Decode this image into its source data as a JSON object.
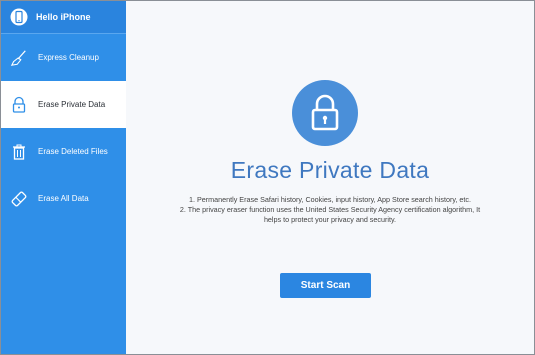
{
  "sidebar": {
    "header": {
      "title": "Hello iPhone",
      "icon": "iphone-icon"
    },
    "items": [
      {
        "label": "Express Cleanup",
        "icon": "broom-icon",
        "active": false
      },
      {
        "label": "Erase Private Data",
        "icon": "lock-icon",
        "active": true
      },
      {
        "label": "Erase Deleted Files",
        "icon": "trash-icon",
        "active": false
      },
      {
        "label": "Erase All Data",
        "icon": "eraser-icon",
        "active": false
      }
    ]
  },
  "main": {
    "icon": "lock-icon",
    "title": "Erase Private Data",
    "desc_line1": "1. Permanently Erase Safari history, Cookies, input history, App Store search history, etc.",
    "desc_line2": "2. The privacy eraser function uses the United States Security Agency certification algorithm, It",
    "desc_line3": "helps to protect your privacy and security.",
    "button_label": "Start Scan"
  },
  "colors": {
    "sidebar_bg": "#2f8fe8",
    "accent": "#2b86e1",
    "title": "#3f78c0",
    "lock_circle": "#4a8fd9"
  }
}
